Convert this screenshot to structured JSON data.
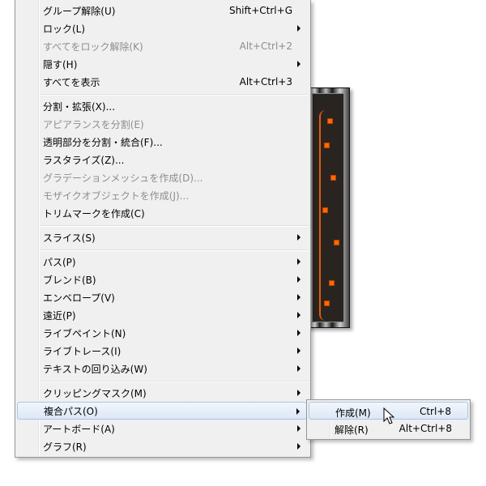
{
  "menu": {
    "items": [
      {
        "label": "グループ解除(U)",
        "shortcut": "Shift+Ctrl+G"
      },
      {
        "label": "ロック(L)",
        "submenu": true
      },
      {
        "label": "すべてをロック解除(K)",
        "shortcut": "Alt+Ctrl+2",
        "disabled": true
      },
      {
        "label": "隠す(H)",
        "submenu": true
      },
      {
        "label": "すべてを表示",
        "shortcut": "Alt+Ctrl+3"
      },
      {
        "label": "分割・拡張(X)..."
      },
      {
        "label": "アピアランスを分割(E)",
        "disabled": true
      },
      {
        "label": "透明部分を分割・統合(F)..."
      },
      {
        "label": "ラスタライズ(Z)..."
      },
      {
        "label": "グラデーションメッシュを作成(D)...",
        "disabled": true
      },
      {
        "label": "モザイクオブジェクトを作成(J)...",
        "disabled": true
      },
      {
        "label": "トリムマークを作成(C)"
      },
      {
        "label": "スライス(S)",
        "submenu": true
      },
      {
        "label": "パス(P)",
        "submenu": true
      },
      {
        "label": "ブレンド(B)",
        "submenu": true
      },
      {
        "label": "エンベロープ(V)",
        "submenu": true
      },
      {
        "label": "遠近(P)",
        "submenu": true
      },
      {
        "label": "ライブペイント(N)",
        "submenu": true
      },
      {
        "label": "ライブトレース(I)",
        "submenu": true
      },
      {
        "label": "テキストの回り込み(W)",
        "submenu": true
      },
      {
        "label": "クリッピングマスク(M)",
        "submenu": true
      },
      {
        "label": "複合パス(O)",
        "submenu": true,
        "active": true
      },
      {
        "label": "アートボード(A)",
        "submenu": true
      },
      {
        "label": "グラフ(R)",
        "submenu": true
      }
    ]
  },
  "submenu": {
    "items": [
      {
        "label": "作成(M)",
        "shortcut": "Ctrl+8",
        "highlighted": true
      },
      {
        "label": "解除(R)",
        "shortcut": "Alt+Ctrl+8"
      }
    ]
  },
  "colors": {
    "menu_bg": "#f0f0f0",
    "highlight_border": "#a8c5e6",
    "disabled_text": "#8d8d8d",
    "anchor": "#ff6a00"
  }
}
